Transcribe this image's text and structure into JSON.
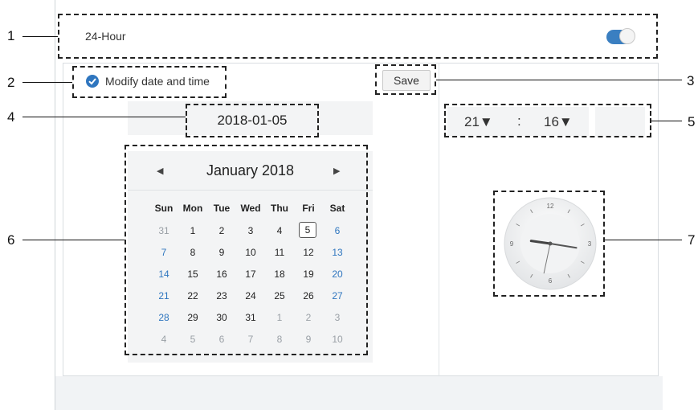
{
  "callouts": [
    "1",
    "2",
    "3",
    "4",
    "5",
    "6",
    "7"
  ],
  "header": {
    "label": "24-Hour",
    "toggle_on": true
  },
  "checkbox": {
    "label": "Modify date and time",
    "checked": true
  },
  "save_label": "Save",
  "date_value": "2018-01-05",
  "calendar": {
    "month_label": "January 2018",
    "prev": "◀",
    "next": "▶",
    "weekdays": [
      "Sun",
      "Mon",
      "Tue",
      "Wed",
      "Thu",
      "Fri",
      "Sat"
    ],
    "weeks": [
      [
        "31",
        "1",
        "2",
        "3",
        "4",
        "5",
        "6"
      ],
      [
        "7",
        "8",
        "9",
        "10",
        "11",
        "12",
        "13"
      ],
      [
        "14",
        "15",
        "16",
        "17",
        "18",
        "19",
        "20"
      ],
      [
        "21",
        "22",
        "23",
        "24",
        "25",
        "26",
        "27"
      ],
      [
        "28",
        "29",
        "30",
        "31",
        "1",
        "2",
        "3"
      ],
      [
        "4",
        "5",
        "6",
        "7",
        "8",
        "9",
        "10"
      ]
    ],
    "selected": "5"
  },
  "time": {
    "hour": "21▼",
    "separator": ":",
    "minute": "16▼"
  },
  "clock": {
    "n12": "12",
    "n3": "3",
    "n6": "6",
    "n9": "9",
    "hour": 21,
    "minute": 16,
    "second": 32
  },
  "colors": {
    "accent": "#2f76bf",
    "weekend": "#2f76bf",
    "muted": "#9aa0a6"
  }
}
